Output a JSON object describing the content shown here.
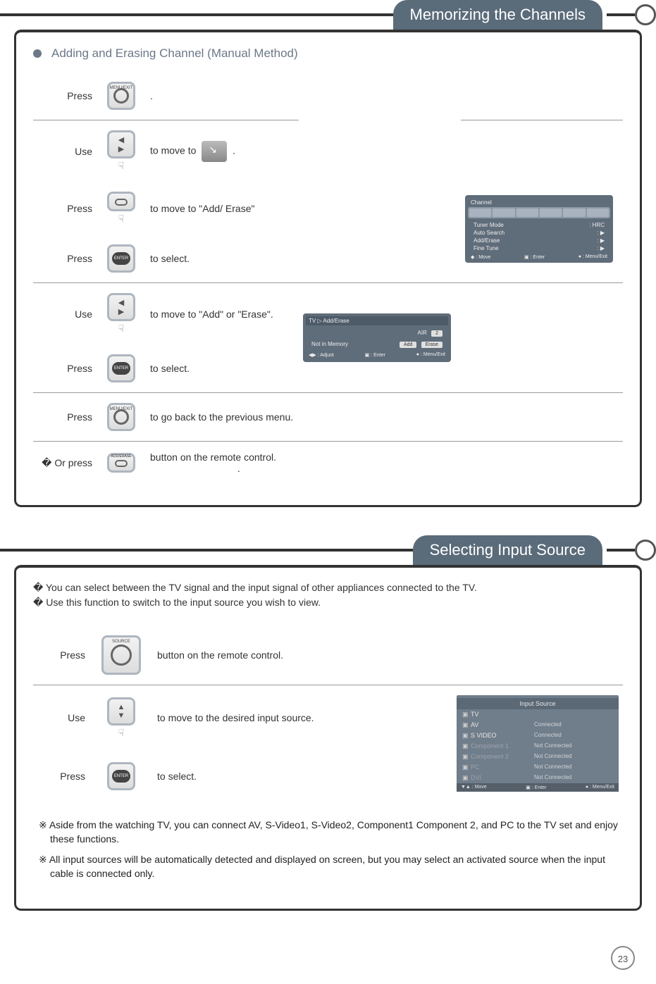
{
  "sections": {
    "memorizing": {
      "header": "Memorizing the Channels",
      "subhead": "Adding and Erasing Channel (Manual Method)",
      "steps": [
        {
          "label": "Press",
          "text": "."
        },
        {
          "label": "Use",
          "text_a": "to move to",
          "text_b": "."
        },
        {
          "label": "Press",
          "text": "to move to \"Add/ Erase\""
        },
        {
          "label": "Press",
          "text": "to select."
        },
        {
          "label": "Use",
          "text": "to move to  \"Add\" or \"Erase\"."
        },
        {
          "label": "Press",
          "text": "to select."
        },
        {
          "label": "Press",
          "text": "to go back to the previous menu."
        },
        {
          "label": "� Or press",
          "text": "button on the remote control.",
          "trail": "."
        }
      ],
      "osd1": {
        "title": "Channel",
        "rows": [
          {
            "k": "Tuner Mode",
            "v": ": HRC"
          },
          {
            "k": "Auto Search",
            "v": ": ▶"
          },
          {
            "k": "Add/Erase",
            "v": ": ▶"
          },
          {
            "k": "Fine Tune",
            "v": ": ▶"
          }
        ],
        "foot": {
          "a": "◆ : Move",
          "b": "▣ : Enter",
          "c": "● : Menu/Exit"
        }
      },
      "osd2": {
        "title": "TV ▷ Add/Erase",
        "sub": "AIR",
        "subv": "2",
        "line": "Not in Memory",
        "btn1": "Add",
        "btn2": "Erase",
        "foot": {
          "a": "◀▶ : Adjust",
          "b": "▣ : Enter",
          "c": "● : Menu/Exit"
        }
      }
    },
    "inputsrc": {
      "header": "Selecting Input Source",
      "intro": [
        "� You can select between the TV signal and the input signal of other appliances connected to the TV.",
        "� Use this function to switch to the input source you wish to view."
      ],
      "steps": [
        {
          "label": "Press",
          "text": "button on the remote control."
        },
        {
          "label": "Use",
          "text": "to move to the desired input source."
        },
        {
          "label": "Press",
          "text": "to select."
        }
      ],
      "osd3": {
        "head": "Input Source",
        "lines": [
          {
            "b": "▣",
            "lbl": "TV",
            "st": ""
          },
          {
            "b": "▣",
            "lbl": "AV",
            "st": "Connected"
          },
          {
            "b": "▣",
            "lbl": "S VIDEO",
            "st": "Connected"
          },
          {
            "b": "▣",
            "lbl": "Component 1",
            "st": "Not Connected"
          },
          {
            "b": "▣",
            "lbl": "Component 2",
            "st": "Not Connected"
          },
          {
            "b": "▣",
            "lbl": "PC",
            "st": "Not Connected"
          },
          {
            "b": "▣",
            "lbl": "DVI",
            "st": "Not Connected"
          }
        ],
        "foot": {
          "a": "▼▲ : Move",
          "b": "▣ : Enter",
          "c": "● : Menu/Exit"
        }
      },
      "notes": [
        "※ Aside from the watching TV, you can connect AV, S-Video1, S-Video2, Component1 Component 2, and PC to the TV set and enjoy these functions.",
        "※ All input sources will be automatically detected and displayed on screen, but you may select an activated source when the input cable is connected only."
      ]
    }
  },
  "buttons": {
    "menu": "MENU/EXIT",
    "enter": "ENTER",
    "source": "SOURCE",
    "adderase": "ADD/ERASE"
  },
  "page_number": "23"
}
